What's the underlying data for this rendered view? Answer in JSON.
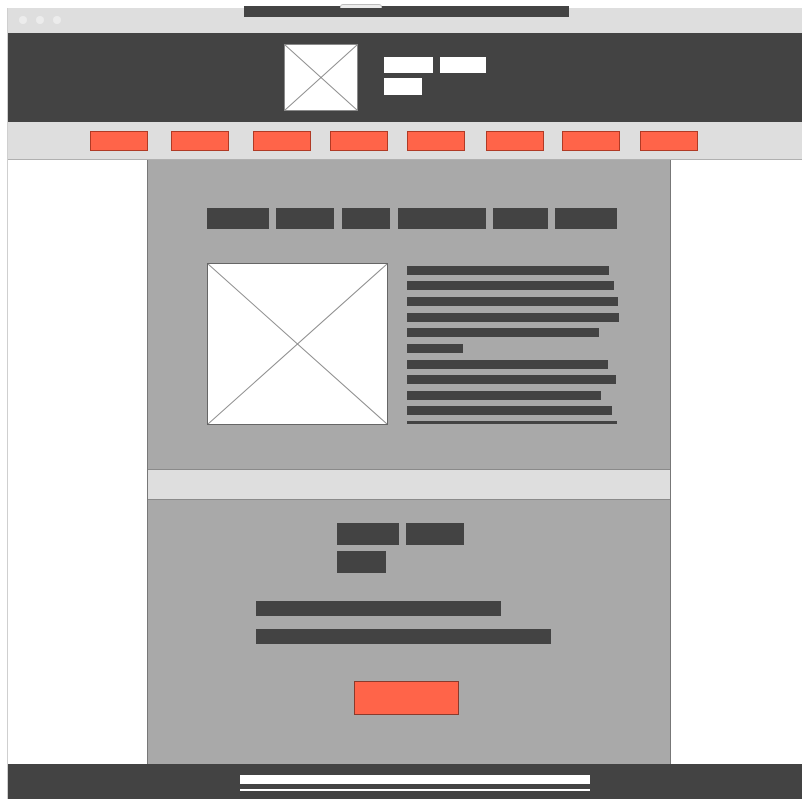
{
  "window": {
    "controls": [
      "close-dot",
      "minimize-dot",
      "maximize-dot"
    ]
  },
  "header": {
    "logo": "image-placeholder-icon"
  },
  "nav": {
    "item_count": 8,
    "accent_color": "#ff6449"
  },
  "main": {
    "image": "image-placeholder-icon"
  },
  "colors": {
    "dark": "#434343",
    "content_bg": "#a9a9a9",
    "light": "#dedede",
    "accent": "#ff6449"
  }
}
